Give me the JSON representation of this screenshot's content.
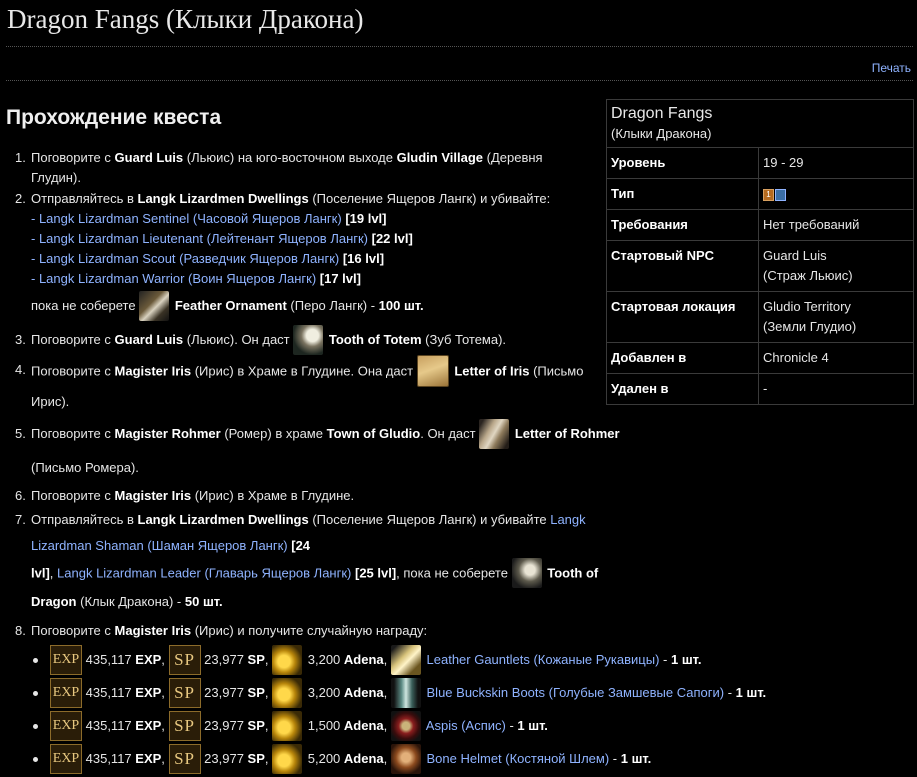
{
  "page_title": "Dragon Fangs (Клыки Дракона)",
  "print_link": "Печать",
  "section_title": "Прохождение квеста",
  "infobox": {
    "name": "Dragon Fangs",
    "name_ru": "(Клыки Дракона)",
    "rows": [
      {
        "label": "Уровень",
        "value": "19 - 29",
        "value2": ""
      },
      {
        "label": "Тип",
        "value": "",
        "value2": "",
        "icon": "quest-type-icon"
      },
      {
        "label": "Требования",
        "value": "Нет требований",
        "value2": ""
      },
      {
        "label": "Стартовый NPC",
        "value": "Guard Luis",
        "value2": "(Страж Льюис)"
      },
      {
        "label": "Стартовая локация",
        "value": "Gludio Territory",
        "value2": "(Земли Глудио)"
      },
      {
        "label": "Добавлен в",
        "value": "Chronicle 4",
        "value2": ""
      },
      {
        "label": "Удален в",
        "value": "-",
        "value2": ""
      }
    ]
  },
  "steps": {
    "s1": {
      "num": "1.",
      "t1": "Поговорите с ",
      "b1": "Guard Luis",
      "t2": " (Льюис) на юго-восточном выходе ",
      "b2": "Gludin Village",
      "t3": " (Деревня",
      "t4": "Глудин)."
    },
    "s2": {
      "num": "2.",
      "t1": "Отправляйтесь в ",
      "b1": "Langk Lizardmen Dwellings",
      "t2": " (Поселение Ящеров Лангк) и убивайте:",
      "mobs": [
        {
          "dash": "- ",
          "name": "Langk Lizardman Sentinel (Часовой Ящеров Лангк)",
          "lvl": " [19 lvl]"
        },
        {
          "dash": "- ",
          "name": "Langk Lizardman Lieutenant (Лейтенант Ящеров Лангк)",
          "lvl": " [22 lvl]"
        },
        {
          "dash": "- ",
          "name": "Langk Lizardman Scout (Разведчик Ящеров Лангк)",
          "lvl": " [16 lvl]"
        },
        {
          "dash": "- ",
          "name": "Langk Lizardman Warrior (Воин Ящеров Лангк)",
          "lvl": " [17 lvl]"
        }
      ],
      "t3": "пока не соберете ",
      "item": "Feather Ornament",
      "t4": " (Перо Лангк) - ",
      "qty": "100 шт."
    },
    "s3": {
      "num": "3.",
      "t1": "Поговорите с ",
      "b1": "Guard Luis",
      "t2": " (Льюис). Он даст ",
      "item": "Tooth of Totem",
      "t3": " (Зуб Тотема)."
    },
    "s4": {
      "num": "4.",
      "t1": "Поговорите с ",
      "b1": "Magister Iris",
      "t2": " (Ирис) в Храме в Глудине. Она даст ",
      "item": "Letter of Iris",
      "t3": " (Письмо",
      "t4": "Ирис)."
    },
    "s5": {
      "num": "5.",
      "t1": "Поговорите с ",
      "b1": "Magister Rohmer",
      "t2": " (Ромер) в храме ",
      "b2": "Town of Gludio",
      "t3": ". Он даст ",
      "item": "Letter of Rohmer",
      "t4": " (Письмо Ромера)."
    },
    "s6": {
      "num": "6.",
      "t1": "Поговорите с ",
      "b1": "Magister Iris",
      "t2": " (Ирис) в Храме в Глудине."
    },
    "s7": {
      "num": "7.",
      "t1": "Отправляйтесь в ",
      "b1": "Langk Lizardmen Dwellings",
      "t2": " (Поселение Ящеров Лангк) и убивайте ",
      "mob1": "Langk Lizardman Shaman (Шаман Ящеров Лангк)",
      "lvl1": " [24",
      "lvl1b": "lvl]",
      "t3": ", ",
      "mob2": "Langk Lizardman Leader (Главарь Ящеров Лангк)",
      "lvl2": " [25 lvl]",
      "t4": ", пока не соберете ",
      "item": "Tooth of Dragon",
      "t5": " (Клык Дракона) - ",
      "qty": "50 шт."
    },
    "s8": {
      "num": "8.",
      "t1": "Поговорите с ",
      "b1": "Magister Iris",
      "t2": " (Ирис) и получите случайную награду:"
    }
  },
  "rewards": [
    {
      "exp_icon": "EXP",
      "exp": "435,117",
      "exp_label": "EXP",
      "sp_icon": "SP",
      "sp": "23,977",
      "sp_label": "SP",
      "adena": "3,200",
      "adena_label": "Adena",
      "item": "Leather Gauntlets (Кожаные Рукавицы)",
      "qty": "1 шт."
    },
    {
      "exp_icon": "EXP",
      "exp": "435,117",
      "exp_label": "EXP",
      "sp_icon": "SP",
      "sp": "23,977",
      "sp_label": "SP",
      "adena": "3,200",
      "adena_label": "Adena",
      "item": "Blue Buckskin Boots (Голубые Замшевые Сапоги)",
      "qty": "1 шт."
    },
    {
      "exp_icon": "EXP",
      "exp": "435,117",
      "exp_label": "EXP",
      "sp_icon": "SP",
      "sp": "23,977",
      "sp_label": "SP",
      "adena": "1,500",
      "adena_label": "Adena",
      "item": "Aspis (Аспис)",
      "qty": "1 шт."
    },
    {
      "exp_icon": "EXP",
      "exp": "435,117",
      "exp_label": "EXP",
      "sp_icon": "SP",
      "sp": "23,977",
      "sp_label": "SP",
      "adena": "5,200",
      "adena_label": "Adena",
      "item": "Bone Helmet (Костяной Шлем)",
      "qty": "1 шт."
    }
  ]
}
